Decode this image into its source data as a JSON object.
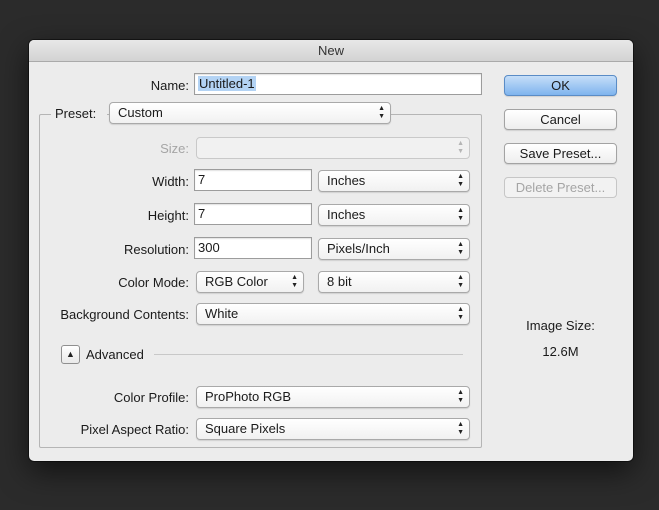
{
  "window": {
    "title": "New"
  },
  "name": {
    "label": "Name:",
    "value": "Untitled-1"
  },
  "preset": {
    "label": "Preset:",
    "value": "Custom"
  },
  "size": {
    "label": "Size:",
    "value": ""
  },
  "width": {
    "label": "Width:",
    "value": "7",
    "unit": "Inches"
  },
  "height": {
    "label": "Height:",
    "value": "7",
    "unit": "Inches"
  },
  "resolution": {
    "label": "Resolution:",
    "value": "300",
    "unit": "Pixels/Inch"
  },
  "color_mode": {
    "label": "Color Mode:",
    "value": "RGB Color",
    "depth": "8 bit"
  },
  "background_contents": {
    "label": "Background Contents:",
    "value": "White"
  },
  "advanced": {
    "label": "Advanced",
    "toggle_glyph": "▲"
  },
  "color_profile": {
    "label": "Color Profile:",
    "value": "ProPhoto RGB"
  },
  "pixel_aspect_ratio": {
    "label": "Pixel Aspect Ratio:",
    "value": "Square Pixels"
  },
  "buttons": {
    "ok": "OK",
    "cancel": "Cancel",
    "save_preset": "Save Preset...",
    "delete_preset": "Delete Preset..."
  },
  "image_size": {
    "label": "Image Size:",
    "value": "12.6M"
  },
  "icons": {
    "popup_arrows": "up-down-chevron-icon",
    "disclosure": "triangle-up-icon"
  }
}
